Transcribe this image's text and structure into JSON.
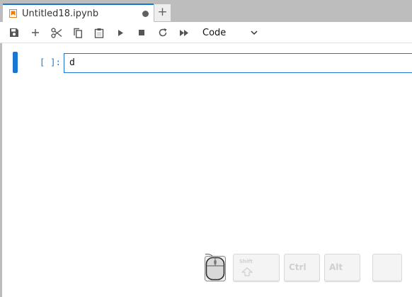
{
  "tab": {
    "title": "Untitled18.ipynb",
    "new_tab_label": "+"
  },
  "toolbar": {
    "buttons": [
      "save-icon",
      "add-icon",
      "cut-icon",
      "copy-icon",
      "paste-icon",
      "run-icon",
      "stop-icon",
      "restart-icon",
      "fast-forward-icon"
    ],
    "cell_type": "Code"
  },
  "cell": {
    "prompt": "[ ]:",
    "source": "d"
  },
  "overlay": {
    "keys": {
      "shift": "Shift",
      "ctrl": "Ctrl",
      "alt": "Alt"
    }
  },
  "colors": {
    "accent": "#1976d2",
    "tab_bar": "#bdbdbd",
    "notebook_icon": "#f57c00"
  }
}
